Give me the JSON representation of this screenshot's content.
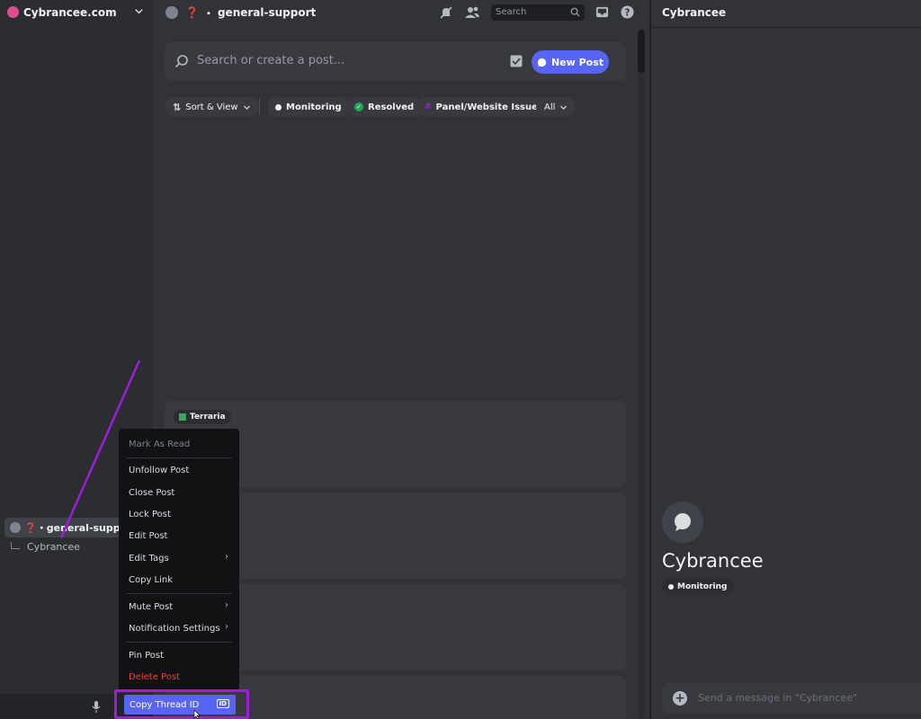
{
  "sidebar": {
    "server_name": "Cybrancee.com",
    "active_channel": "❓・general-supp…",
    "thread_name": "Cybrancee"
  },
  "main": {
    "channel_name": "general-support",
    "search_placeholder": "Search",
    "post_search_placeholder": "Search or create a post...",
    "new_post_label": "New Post",
    "filters": {
      "sort_label": "Sort & View",
      "tags": [
        "Monitoring",
        "Resolved",
        "Panel/Website Issues"
      ],
      "all_label": "All"
    },
    "first_card_tag": "Terraria"
  },
  "right": {
    "title": "Cybrancee",
    "thread_title": "Cybrancee",
    "thread_tag": "Monitoring",
    "message_placeholder": "Send a message in \"Cybrancee\""
  },
  "context_menu": {
    "items": [
      "Mark As Read",
      "Unfollow Post",
      "Close Post",
      "Lock Post",
      "Edit Post",
      "Edit Tags",
      "Copy Link",
      "Mute Post",
      "Notification Settings",
      "Pin Post",
      "Delete Post",
      "Copy Thread ID"
    ],
    "id_badge": "ID"
  },
  "colors": {
    "accent": "#5865f2",
    "annotation": "#9b1fd8",
    "danger": "#f23f43",
    "resolved": "#23a55a"
  }
}
